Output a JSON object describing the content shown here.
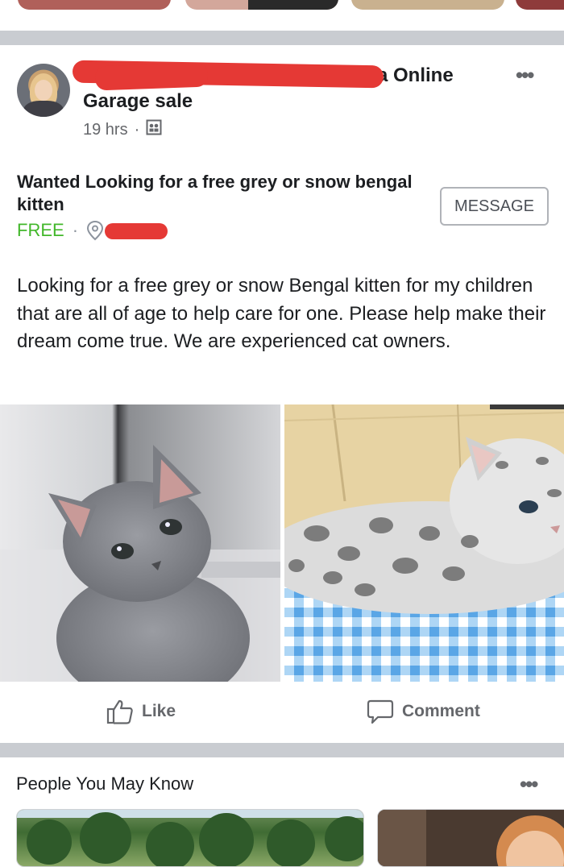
{
  "post": {
    "group_name_visible": "a Online",
    "group_subtitle": "Garage sale",
    "time": "19 hrs",
    "privacy_icon": "group-members-icon",
    "more_icon": "more-dots-icon"
  },
  "listing": {
    "title": "Wanted Looking for a free grey or snow bengal kitten",
    "price": "FREE",
    "location_icon": "location-pin-icon",
    "message_button": "MESSAGE",
    "description": "Looking for a free grey or snow Bengal kitten for my children that are all of age to help care for one. Please help make their dream come true. We are experienced cat owners."
  },
  "photos": [
    {
      "subject": "grey-kitten-photo"
    },
    {
      "subject": "snow-bengal-kitten-photo"
    }
  ],
  "actions": {
    "like_label": "Like",
    "comment_label": "Comment"
  },
  "people_you_may_know": {
    "title": "People You May Know"
  },
  "colors": {
    "price_green": "#42b72a",
    "separator": "#c9ccd1",
    "muted_text": "#65676b",
    "redaction": "#e53935"
  }
}
